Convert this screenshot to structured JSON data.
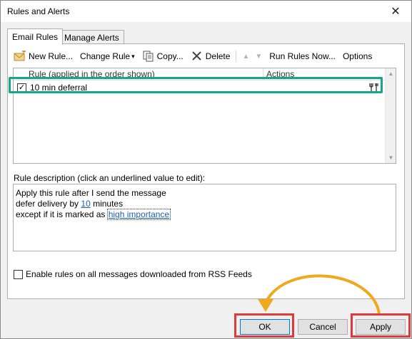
{
  "window": {
    "title": "Rules and Alerts",
    "close_glyph": "✕"
  },
  "tabs": [
    {
      "label": "Email Rules",
      "active": true
    },
    {
      "label": "Manage Alerts",
      "active": false
    }
  ],
  "toolbar": {
    "new_rule": "New Rule...",
    "change_rule": "Change Rule",
    "change_rule_arrow": "▾",
    "copy": "Copy...",
    "delete": "Delete",
    "move_up": "▲",
    "move_down": "▼",
    "run_rules": "Run Rules Now...",
    "options": "Options"
  },
  "rules_list": {
    "col_rule": "Rule (applied in the order shown)",
    "col_actions": "Actions",
    "rows": [
      {
        "name": "10 min deferral",
        "checked": true,
        "action_icon": "defer-action-icon"
      }
    ]
  },
  "description": {
    "label": "Rule description (click an underlined value to edit):",
    "line1": "Apply this rule after I send the message",
    "line2_pre": "defer delivery by ",
    "line2_link": "10",
    "line2_post": " minutes",
    "line3_pre": "except if it is marked as ",
    "line3_link": "high importance"
  },
  "rss": {
    "label": "Enable rules on all messages downloaded from RSS Feeds",
    "checked": false
  },
  "buttons": {
    "ok": "OK",
    "cancel": "Cancel",
    "apply": "Apply"
  },
  "colors": {
    "highlight_green": "#13a889",
    "highlight_red": "#e0393b",
    "arrow_orange": "#f0a81e",
    "link": "#1a5fb4"
  }
}
